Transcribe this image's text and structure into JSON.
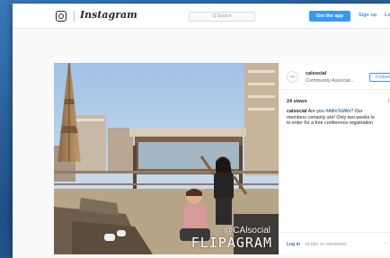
{
  "header": {
    "brand": "Instagram",
    "search_placeholder": "Q  Search",
    "get_app": "Get the app",
    "signup": "Sign up",
    "login_partial": "Lo"
  },
  "post": {
    "watermark_handle": "@CAlsocial",
    "watermark_brand": "FLIPAGRAM",
    "author": {
      "username": "calsocial",
      "location": "Community Associat...",
      "avatar_text": "CAI"
    },
    "follow_label": "Follow",
    "views": "24 views",
    "views_extra": "1",
    "caption": {
      "username": "calsocial",
      "line1_text": " Are you ",
      "hashtag": "#AllInToWin",
      "line1_end": "? Our",
      "line2": "members certainly are! Only two weeks le",
      "line3": "to enter for a free conference registration"
    },
    "login_link": "Log in",
    "login_rest": " to like or comment.",
    "more": "..."
  },
  "colors": {
    "accent": "#3897f0",
    "link": "#003569"
  }
}
